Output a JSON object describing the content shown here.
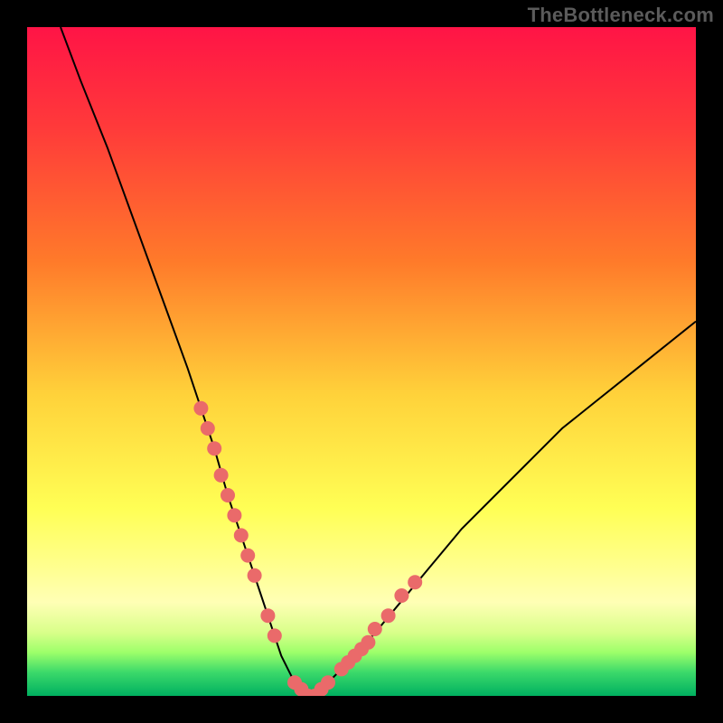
{
  "watermark": "TheBottleneck.com",
  "colors": {
    "frame": "#000000",
    "curve": "#000000",
    "dots": "#ea6a6a",
    "watermark": "#5b5b5b",
    "gradient_stops": [
      {
        "offset": 0.0,
        "color": "#ff1446"
      },
      {
        "offset": 0.15,
        "color": "#ff3a3a"
      },
      {
        "offset": 0.35,
        "color": "#ff7a2a"
      },
      {
        "offset": 0.55,
        "color": "#ffd23a"
      },
      {
        "offset": 0.72,
        "color": "#ffff55"
      },
      {
        "offset": 0.8,
        "color": "#ffff8a"
      },
      {
        "offset": 0.86,
        "color": "#ffffb5"
      },
      {
        "offset": 0.905,
        "color": "#d9ff8a"
      },
      {
        "offset": 0.935,
        "color": "#9dff6a"
      },
      {
        "offset": 0.965,
        "color": "#3bd96a"
      },
      {
        "offset": 1.0,
        "color": "#00b060"
      }
    ]
  },
  "chart_data": {
    "type": "line",
    "title": "",
    "xlabel": "",
    "ylabel": "",
    "xlim": [
      0,
      100
    ],
    "ylim": [
      0,
      100
    ],
    "grid": false,
    "legend": false,
    "series": [
      {
        "name": "bottleneck-curve",
        "x": [
          5,
          8,
          12,
          16,
          20,
          24,
          26,
          28,
          30,
          32,
          33,
          34,
          35,
          36,
          37,
          38,
          39,
          40,
          42,
          45,
          50,
          55,
          60,
          65,
          70,
          75,
          80,
          85,
          90,
          95,
          100
        ],
        "y": [
          100,
          92,
          82,
          71,
          60,
          49,
          43,
          37,
          30,
          24,
          21,
          18,
          15,
          12,
          9,
          6,
          4,
          2,
          0,
          2,
          7,
          13,
          19,
          25,
          30,
          35,
          40,
          44,
          48,
          52,
          56
        ]
      }
    ],
    "dots": {
      "name": "highlight-dots",
      "x": [
        26,
        27,
        28,
        29,
        30,
        31,
        32,
        33,
        34,
        36,
        37,
        40,
        41,
        42,
        43,
        44,
        45,
        47,
        48,
        49,
        50,
        51,
        52,
        54,
        56,
        58
      ],
      "y": [
        43,
        40,
        37,
        33,
        30,
        27,
        24,
        21,
        18,
        12,
        9,
        2,
        1,
        0,
        0,
        1,
        2,
        4,
        5,
        6,
        7,
        8,
        10,
        12,
        15,
        17
      ]
    }
  }
}
